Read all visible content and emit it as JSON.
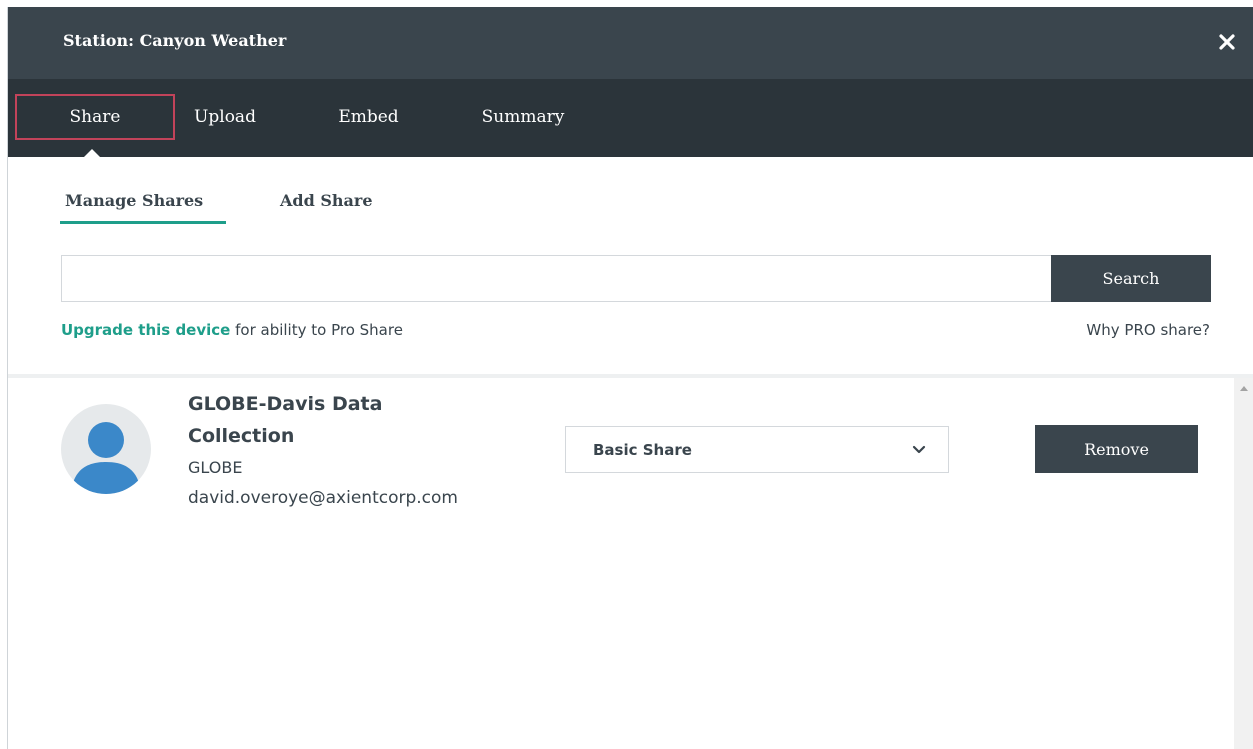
{
  "window": {
    "title": "Station: Canyon Weather"
  },
  "tabs": [
    {
      "label": "Share",
      "active": true
    },
    {
      "label": "Upload"
    },
    {
      "label": "Embed"
    },
    {
      "label": "Summary"
    }
  ],
  "subtabs": [
    {
      "label": "Manage Shares",
      "active": true
    },
    {
      "label": "Add Share"
    }
  ],
  "search": {
    "value": "",
    "placeholder": "",
    "button_label": "Search"
  },
  "upgrade": {
    "link_text": "Upgrade this device",
    "text": " for ability to Pro Share",
    "why_pro_label": "Why PRO share?"
  },
  "shares": [
    {
      "name": "GLOBE-Davis Data Collection",
      "org": "GLOBE",
      "email": "david.overoye@axientcorp.com",
      "share_type": "Basic Share",
      "remove_label": "Remove"
    }
  ],
  "icons": {
    "close": "close-icon",
    "avatar": "user-avatar-icon",
    "dropdown": "chevron-down-icon",
    "scroll_up": "scroll-up-arrow-icon"
  },
  "colors": {
    "header_bg": "#3a454d",
    "tabbar_bg": "#2b343a",
    "accent": "#1e9e8a",
    "active_tab_border": "#c2435a",
    "avatar_blue": "#3b88c9"
  }
}
